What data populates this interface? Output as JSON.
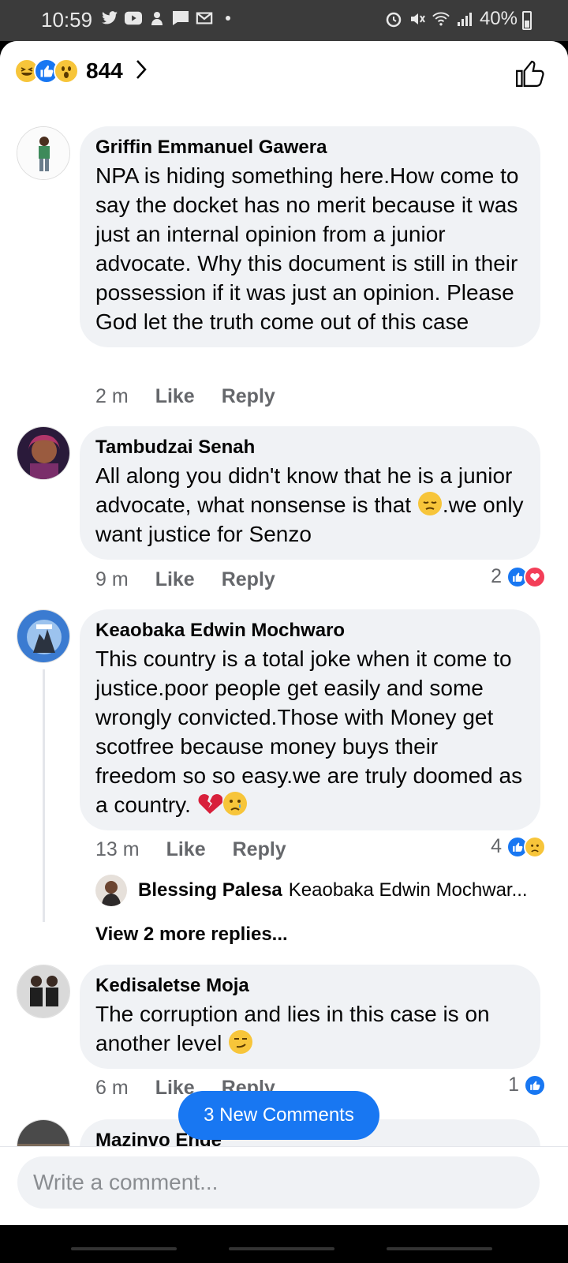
{
  "status_bar": {
    "time": "10:59",
    "battery": "40%"
  },
  "reactions": {
    "count": "844"
  },
  "comments": [
    {
      "name": "Griffin Emmanuel Gawera",
      "text": "NPA is hiding something here.How come to say the docket has no merit because it was just an internal opinion from a junior advocate. Why this document is still in their possession if it was just an opinion. Please God let the truth  come out of this case",
      "time": "2 m",
      "like": "Like",
      "reply": "Reply"
    },
    {
      "name": "Tambudzai Senah",
      "text_part1": "All along you didn't know  that he is a junior advocate, what nonsense is that ",
      "text_part2": ".we only want justice for Senzo",
      "time": "9 m",
      "like": "Like",
      "reply": "Reply",
      "reaction_count": "2"
    },
    {
      "name": "Keaobaka Edwin Mochwaro",
      "text": "This country is a total joke when it come to justice.poor people get easily  and some wrongly convicted.Those with Money get scotfree because money buys their freedom so so easy.we are truly doomed as a country. ",
      "time": "13 m",
      "like": "Like",
      "reply": "Reply",
      "reaction_count": "4",
      "reply_preview": {
        "name": "Blessing Palesa",
        "text": "Keaobaka Edwin Mochwar..."
      },
      "view_more": "View 2 more replies..."
    },
    {
      "name": "Kedisaletse Moja",
      "text": "The corruption and lies in this case is on another level ",
      "time": "6 m",
      "like": "Like",
      "reply": "Reply",
      "reaction_count": "1"
    },
    {
      "name": "Mazinvo Ende"
    }
  ],
  "new_comments_button": "3 New Comments",
  "composer": {
    "placeholder": "Write a comment..."
  },
  "colors": {
    "accent": "#1877f2",
    "bubble": "#f0f2f5",
    "love": "#f33e58"
  }
}
